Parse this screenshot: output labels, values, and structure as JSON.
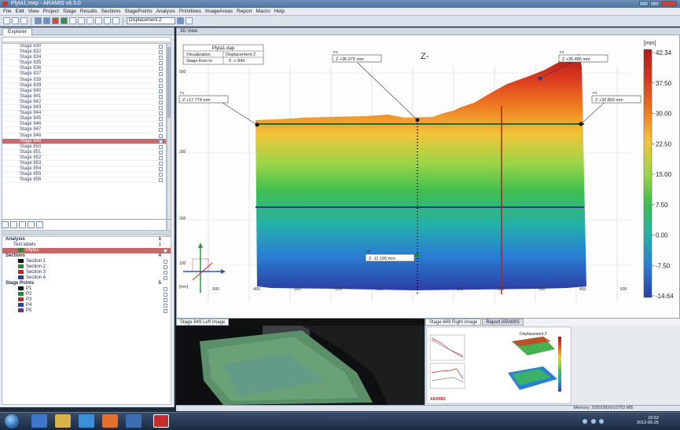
{
  "window": {
    "title": "Plyta1.mep - ARAMIS v6.3.0"
  },
  "menu": [
    "File",
    "Edit",
    "View",
    "Project",
    "Stage",
    "Results",
    "Sections",
    "StagePoints",
    "Analysis",
    "Primitives",
    "ImageAreas",
    "Report",
    "Macro",
    "Help"
  ],
  "toolbar": {
    "result_select": "Displacement Z"
  },
  "explorer": {
    "tab": "Explorer",
    "stages": [
      "Stage 830",
      "Stage 832",
      "Stage 834",
      "Stage 835",
      "Stage 836",
      "Stage 837",
      "Stage 838",
      "Stage 839",
      "Stage 840",
      "Stage 841",
      "Stage 842",
      "Stage 843",
      "Stage 844",
      "Stage 845",
      "Stage 846",
      "Stage 847",
      "Stage 848",
      "Stage 849",
      "Stage 850",
      "Stage 851",
      "Stage 852",
      "Stage 853",
      "Stage 854",
      "Stage 855",
      "Stage 856"
    ],
    "selected": "Stage 849"
  },
  "tree": {
    "analysis": {
      "label": "Analysis",
      "count": "1"
    },
    "text_labels": {
      "label": "Text labels",
      "count": "1"
    },
    "text_item": "Plyta1",
    "sections": {
      "label": "Sections",
      "count": "4"
    },
    "section_items": [
      {
        "label": "Section 1",
        "color": "#111111"
      },
      {
        "label": "Section 2",
        "color": "#1f8a2e"
      },
      {
        "label": "Section 3",
        "color": "#c02626"
      },
      {
        "label": "Section 4",
        "color": "#2b3fa3"
      }
    ],
    "stage_points": {
      "label": "Stage Points",
      "count": "5"
    },
    "point_items": [
      {
        "label": "P1",
        "color": "#111111"
      },
      {
        "label": "P2",
        "color": "#1f8a2e"
      },
      {
        "label": "P3",
        "color": "#c02626"
      },
      {
        "label": "P4",
        "color": "#2b3fa3"
      },
      {
        "label": "P5",
        "color": "#7a2a8a"
      }
    ]
  },
  "view3d": {
    "tab": "3D View",
    "info_title": "Plyta1.dap",
    "info_left": "Visualization",
    "info_right": "Displacement Z",
    "info_row2_left": "Stage from to",
    "info_row2_right": "0 -> 849",
    "axis_label": "Z-",
    "unit": "[mm]",
    "z_axis_unit": "[mm]",
    "z_ticks": [
      "500",
      "300",
      "200",
      "100"
    ],
    "x_ticks": [
      "-500",
      "-400",
      "-300",
      "-200",
      "-100",
      "0",
      "100",
      "200",
      "300",
      "400",
      "500"
    ],
    "labels": [
      {
        "name": "P1",
        "text": "Z +17.774 mm"
      },
      {
        "name": "P2",
        "text": "Z +36.070 mm"
      },
      {
        "name": "P3",
        "text": "Z +32.856 mm"
      },
      {
        "name": "P4",
        "text": "Z +35.485 mm"
      },
      {
        "name": "P5",
        "text": "Z -11.195 mm"
      }
    ],
    "colorbar": {
      "ticks": [
        "42.34",
        "37.50",
        "30.00",
        "22.50",
        "15.00",
        "7.50",
        "0.00",
        "-7.50",
        "-14.64"
      ],
      "stops": [
        "#b01b1b",
        "#d9381e",
        "#ef7b22",
        "#f0c43a",
        "#9dd548",
        "#3fbe4f",
        "#25b0a8",
        "#2a7fd4",
        "#2b3fa3"
      ]
    }
  },
  "left_image": {
    "tab": "Stage 849 Left Image"
  },
  "right_image": {
    "tab1": "Stage 849 Right Image",
    "tab2": "Report ARAMIS",
    "report_title": "Displacement Z",
    "report_footer": "ARAMIS"
  },
  "status": {
    "memory": "Memory: 2050/3826/10753 MB"
  },
  "tray": {
    "time": "16:52",
    "date": "2012-05-25"
  }
}
